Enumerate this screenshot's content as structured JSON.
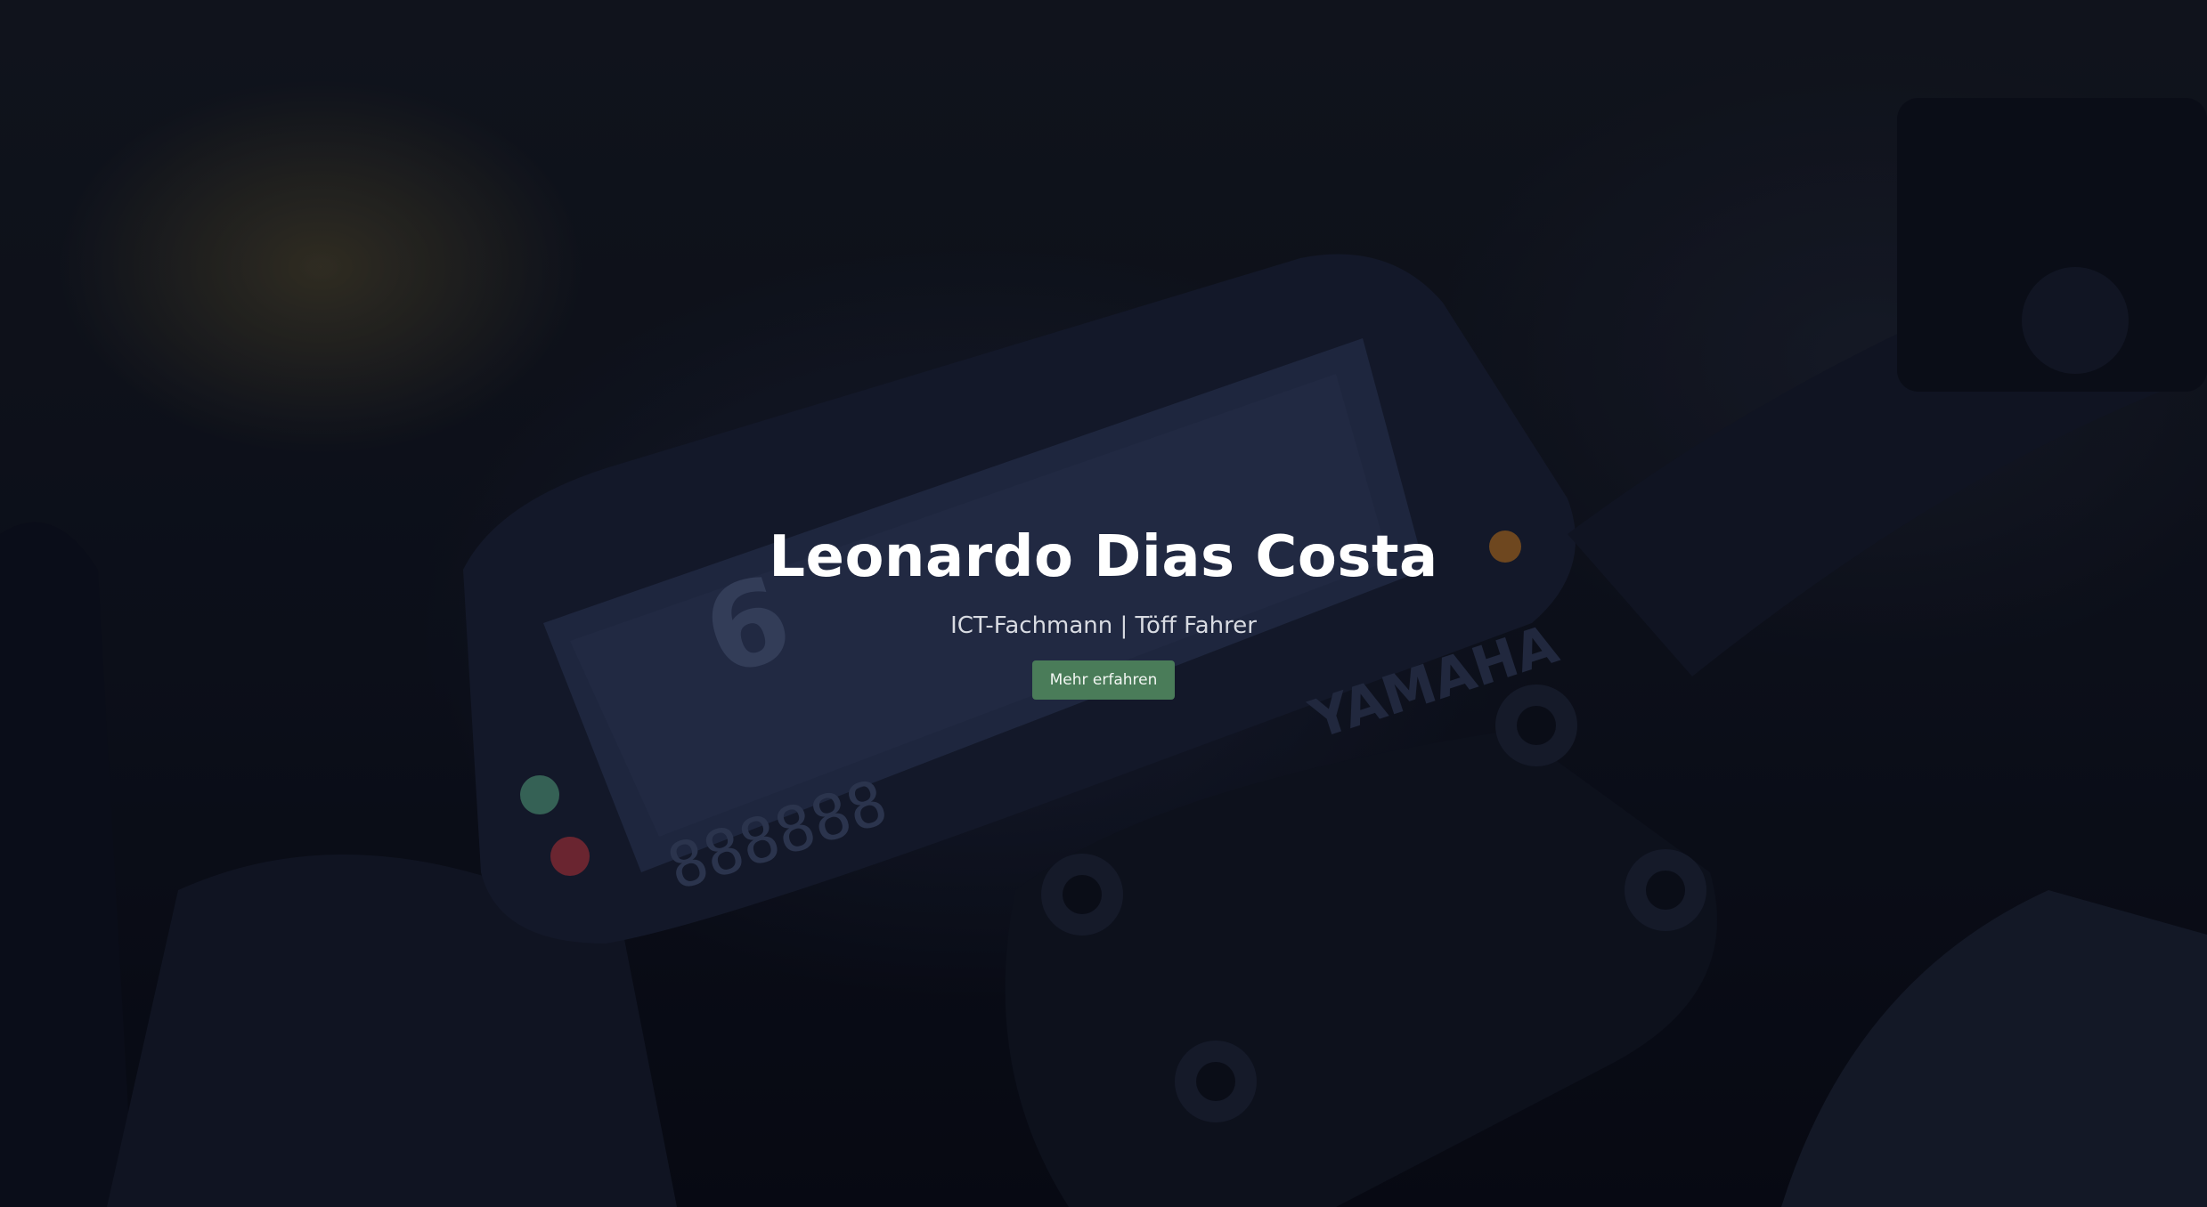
{
  "hero": {
    "name": "Leonardo Dias Costa",
    "tagline": "ICT-Fachmann | Töff Fahrer",
    "cta_label": "Mehr erfahren"
  },
  "colors": {
    "button_bg": "#4a7c59",
    "title_text": "#ffffff",
    "overlay": "#080c1c"
  },
  "background": {
    "description_icon": "motorcycle-dashboard-image"
  }
}
